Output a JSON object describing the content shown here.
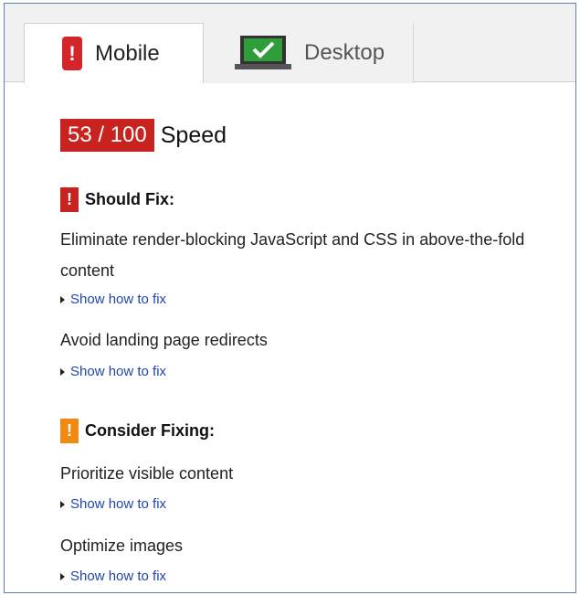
{
  "tabs": [
    {
      "label": "Mobile",
      "icon": "mobile-phone-alert-icon",
      "active": true
    },
    {
      "label": "Desktop",
      "icon": "laptop-check-icon",
      "active": false
    }
  ],
  "score": {
    "value": "53 / 100",
    "label": "Speed",
    "color": "#c9231f"
  },
  "sections": [
    {
      "title": "Should Fix:",
      "flag": "!",
      "color": "#c9231f",
      "rules": [
        {
          "text": "Eliminate render-blocking JavaScript and CSS in above-the-fold content",
          "link": "Show how to fix"
        },
        {
          "text": "Avoid landing page redirects",
          "link": "Show how to fix"
        }
      ]
    },
    {
      "title": "Consider Fixing:",
      "flag": "!",
      "color": "#f08a12",
      "rules": [
        {
          "text": "Prioritize visible content",
          "link": "Show how to fix"
        },
        {
          "text": "Optimize images",
          "link": "Show how to fix"
        }
      ]
    }
  ]
}
